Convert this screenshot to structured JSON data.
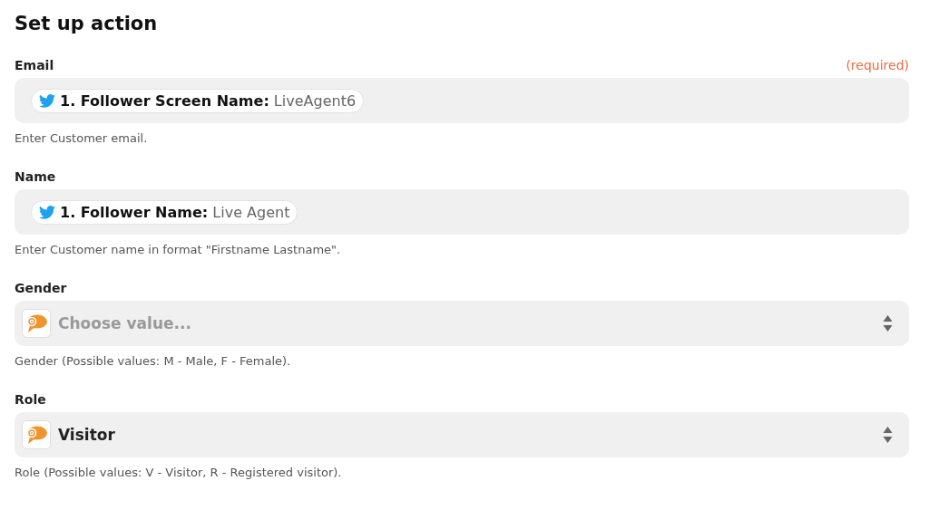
{
  "title": "Set up action",
  "fields": [
    {
      "label": "Email",
      "required": "(required)",
      "kind": "pill",
      "pill": "**1. Follower Screen Name:** LiveAgent6",
      "help": "Enter Customer email."
    },
    {
      "label": "Name",
      "kind": "pill",
      "pill": "**1. Follower Name:** Live Agent",
      "help": "Enter Customer name in format \"Firstname Lastname\"."
    },
    {
      "label": "Gender",
      "kind": "select",
      "placeholder": "Choose value...",
      "help": "Gender (Possible values: M - Male, F - Female)."
    },
    {
      "label": "Role",
      "kind": "select",
      "value": "Visitor",
      "help": "Role (Possible values: V - Visitor, R - Registered visitor)."
    }
  ]
}
